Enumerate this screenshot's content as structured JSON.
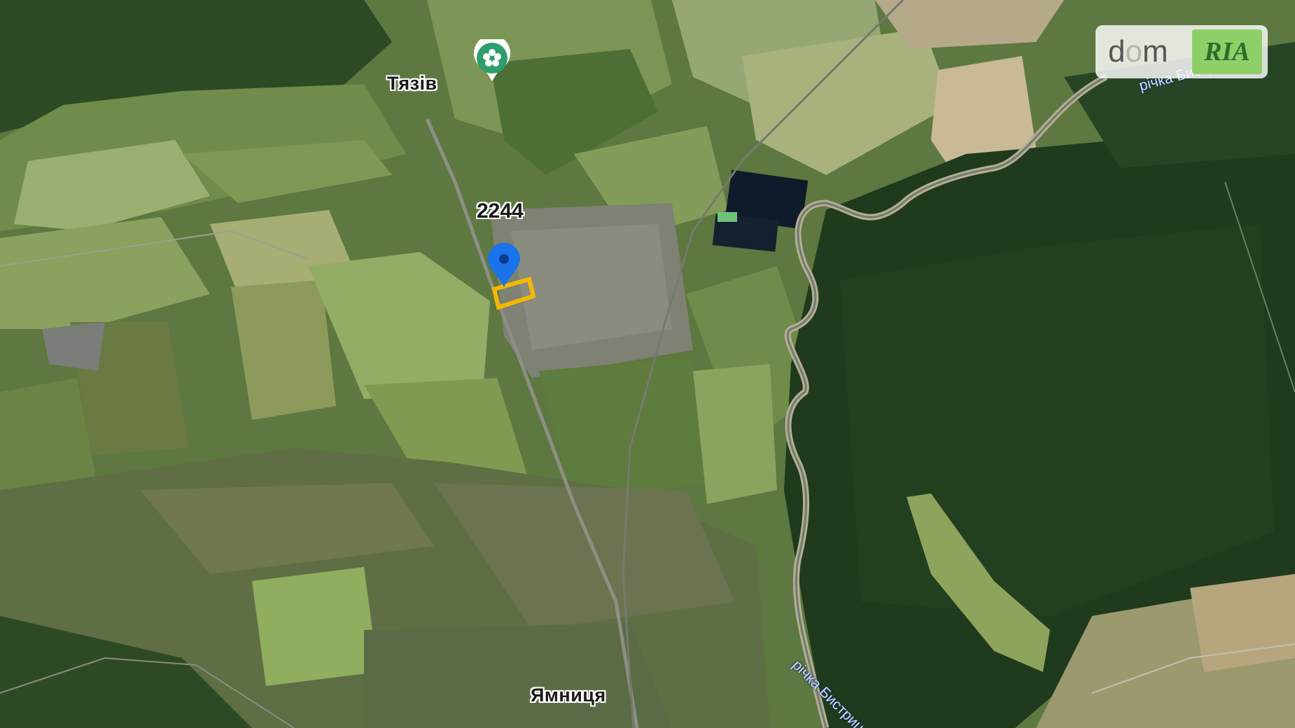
{
  "map": {
    "places": {
      "tiaziv": "Тязів",
      "yamnytsia": "Ямниця"
    },
    "road_number": "2244",
    "rivers": {
      "top": "річка Бистриця",
      "bottom": "річка Бистриця"
    },
    "poi": {
      "icon": "flower-poi-icon",
      "color": "#2f9e6e"
    },
    "location_pin": {
      "icon": "location-pin-icon",
      "color": "#1a73e8"
    },
    "plot_outline": {
      "color": "#f5b800"
    }
  },
  "watermark": {
    "dom_d": "d",
    "dom_o": "o",
    "dom_m": "m",
    "ria": "RIA",
    "accent": "#8fcf6a"
  }
}
